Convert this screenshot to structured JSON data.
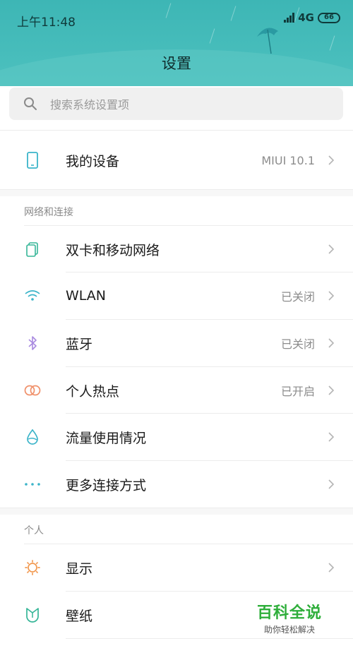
{
  "status": {
    "time": "上午11:48",
    "network": "4G",
    "battery": "66"
  },
  "header": {
    "title": "设置"
  },
  "search": {
    "placeholder": "搜索系统设置项"
  },
  "device": {
    "label": "我的设备",
    "value": "MIUI 10.1"
  },
  "sections": {
    "network_title": "网络和连接",
    "personal_title": "个人"
  },
  "network_items": [
    {
      "label": "双卡和移动网络",
      "value": "",
      "icon": "dual-sim-icon"
    },
    {
      "label": "WLAN",
      "value": "已关闭",
      "icon": "wifi-icon"
    },
    {
      "label": "蓝牙",
      "value": "已关闭",
      "icon": "bluetooth-icon"
    },
    {
      "label": "个人热点",
      "value": "已开启",
      "icon": "hotspot-icon"
    },
    {
      "label": "流量使用情况",
      "value": "",
      "icon": "data-usage-icon"
    },
    {
      "label": "更多连接方式",
      "value": "",
      "icon": "more-dots-icon"
    }
  ],
  "personal_items": [
    {
      "label": "显示",
      "value": "",
      "icon": "brightness-icon"
    },
    {
      "label": "壁纸",
      "value": "",
      "icon": "wallpaper-icon"
    }
  ],
  "watermark": {
    "title": "百科全说",
    "subtitle": "助你轻松解决"
  },
  "colors": {
    "header": "#3db6b5",
    "wifi": "#3bb4c9",
    "bluetooth": "#a98ae0",
    "hotspot": "#f0906a",
    "brightness": "#f29a52",
    "watermark": "#2eae3a"
  }
}
